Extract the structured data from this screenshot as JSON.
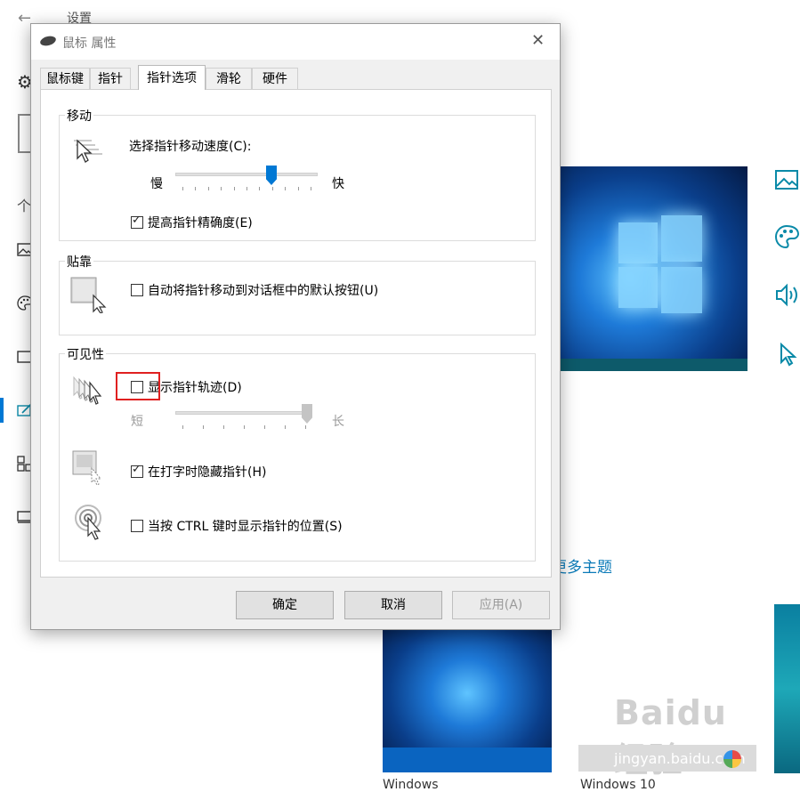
{
  "background": {
    "title": "设置",
    "sidebar_partial_label": "个",
    "more_themes_link": "更多主题",
    "thumb_captions": [
      "Windows",
      "Windows 10"
    ],
    "icons": [
      "back-arrow-icon",
      "gear-icon",
      "image-icon",
      "palette-icon",
      "taskbar-icon",
      "edit-icon",
      "grid-icon",
      "monitor-icon"
    ],
    "right_icons": [
      "image-icon",
      "palette-icon",
      "speaker-icon",
      "cursor-icon"
    ],
    "watermark": {
      "brand": "Baidu经验",
      "url": "jingyan.baidu.com"
    }
  },
  "dialog": {
    "title": "鼠标 属性",
    "tabs": [
      {
        "label": "鼠标键"
      },
      {
        "label": "指针"
      },
      {
        "label": "指针选项",
        "active": true
      },
      {
        "label": "滑轮"
      },
      {
        "label": "硬件"
      }
    ],
    "motion": {
      "group_label": "移动",
      "speed_label": "选择指针移动速度(C):",
      "slow_label": "慢",
      "fast_label": "快",
      "speed_level": 0.69,
      "precision_label": "提高指针精确度(E)",
      "precision_checked": true
    },
    "snap": {
      "group_label": "贴靠",
      "snap_label": "自动将指针移动到对话框中的默认按钮(U)",
      "snap_checked": false
    },
    "visibility": {
      "group_label": "可见性",
      "trails_label": "显示指针轨迹(D)",
      "trails_checked": false,
      "short_label": "短",
      "long_label": "长",
      "trail_level": 1.0,
      "hide_typing_label": "在打字时隐藏指针(H)",
      "hide_typing_checked": true,
      "ctrl_locate_label": "当按 CTRL 键时显示指针的位置(S)",
      "ctrl_locate_checked": false
    },
    "buttons": {
      "ok": "确定",
      "cancel": "取消",
      "apply": "应用(A)"
    }
  },
  "colors": {
    "accent": "#0078d4",
    "highlight_box": "#e02020",
    "link": "#0a7ab8"
  }
}
